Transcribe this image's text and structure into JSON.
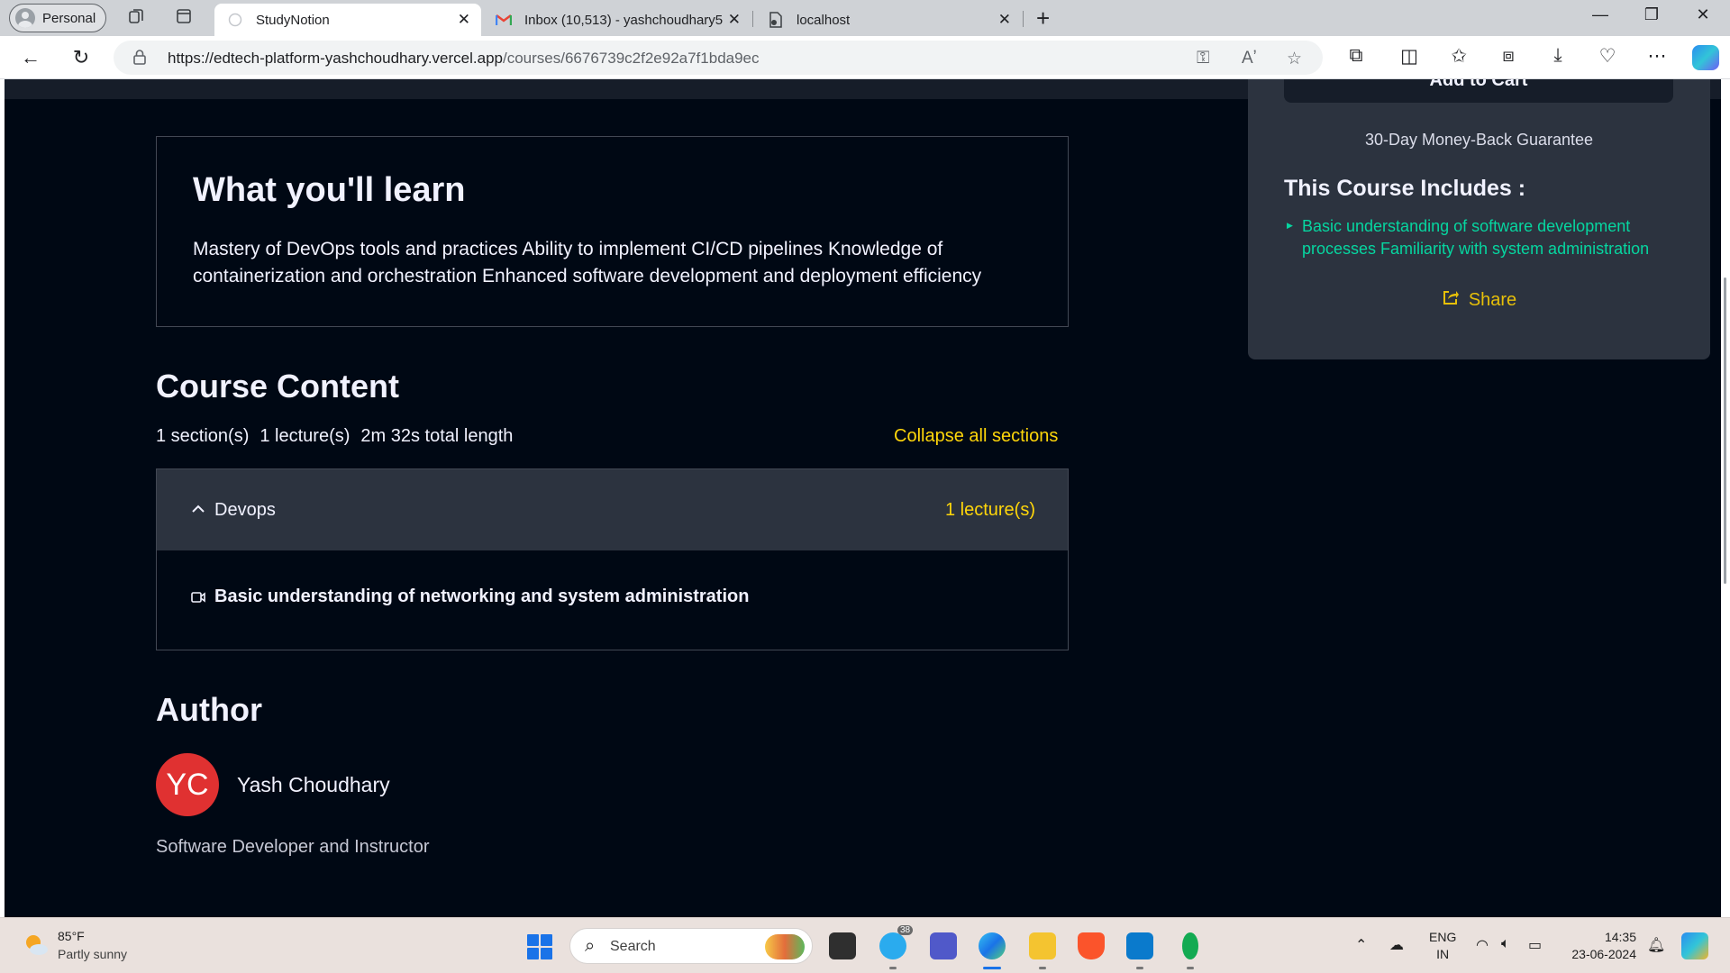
{
  "browser": {
    "profile_label": "Personal",
    "tabs": [
      {
        "title": "StudyNotion",
        "active": true
      },
      {
        "title": "Inbox (10,513) - yashchoudhary5",
        "active": false
      },
      {
        "title": "localhost",
        "active": false
      }
    ],
    "url_host": "https://edtech-platform-yashchoudhary.vercel.app",
    "url_path": "/courses/6676739c2f2e92a7f1bda9ec"
  },
  "sidebar_card": {
    "cart_label": "Add to Cart",
    "guarantee": "30-Day Money-Back Guarantee",
    "includes_title": "This Course Includes :",
    "includes_items": [
      "Basic understanding of software development processes Familiarity with system administration"
    ],
    "share_label": "Share"
  },
  "learn": {
    "title": "What you'll learn",
    "text": "Mastery of DevOps tools and practices Ability to implement CI/CD pipelines Knowledge of containerization and orchestration Enhanced software development and deployment efficiency"
  },
  "course_content": {
    "title": "Course Content",
    "sections_count": "1 section(s)",
    "lectures_count": "1 lecture(s)",
    "total_length": "2m 32s total length",
    "collapse_label": "Collapse all sections",
    "sections": [
      {
        "name": "Devops",
        "lecture_count": "1 lecture(s)",
        "lectures": [
          "Basic understanding of networking and system administration"
        ]
      }
    ]
  },
  "author": {
    "title": "Author",
    "initials": "YC",
    "name": "Yash Choudhary",
    "bio": "Software Developer and Instructor"
  },
  "taskbar": {
    "weather_temp": "85°F",
    "weather_desc": "Partly sunny",
    "search_placeholder": "Search",
    "telegram_badge": "38",
    "lang_line1": "ENG",
    "lang_line2": "IN",
    "time": "14:35",
    "date": "23-06-2024"
  },
  "colors": {
    "page_bg": "#000814",
    "panel_bg": "#2c333f",
    "accent_yellow": "#ffd60a",
    "accent_green": "#06d6a0",
    "avatar_red": "#e03131"
  }
}
